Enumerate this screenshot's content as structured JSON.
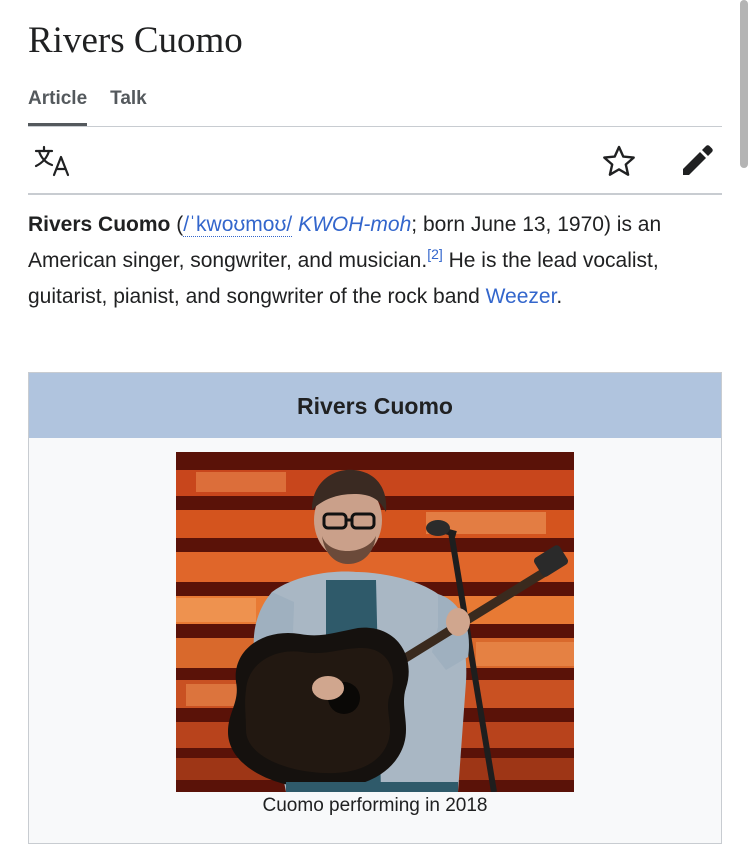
{
  "page": {
    "title": "Rivers Cuomo"
  },
  "tabs": [
    {
      "label": "Article",
      "active": true
    },
    {
      "label": "Talk",
      "active": false
    }
  ],
  "toolbar": {
    "language_icon": "translate-icon",
    "watch_icon": "star-icon",
    "edit_icon": "pencil-icon"
  },
  "lead": {
    "subject": "Rivers Cuomo",
    "open_paren": " (",
    "ipa": "/ˈkwoʊmoʊ/",
    "respelling": "KWOH-moh",
    "text1": "; born June 13, 1970) is an American singer, songwriter, and musician.",
    "ref": "[2]",
    "text2": " He is the lead vocalist, guitarist, pianist, and songwriter of the rock band ",
    "band_link": "Weezer",
    "end": "."
  },
  "infobox": {
    "title": "Rivers Cuomo",
    "image_caption": "Cuomo performing in 2018",
    "header_color": "#b0c4de"
  },
  "colors": {
    "link": "#3366cc",
    "text": "#202122"
  }
}
